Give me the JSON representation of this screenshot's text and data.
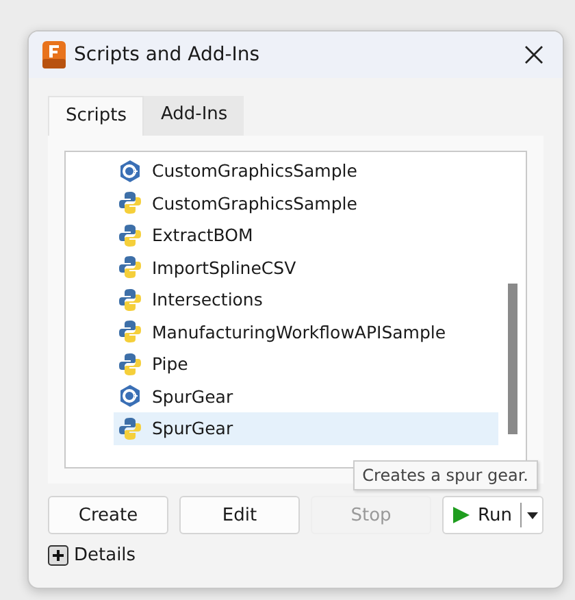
{
  "window": {
    "title": "Scripts and Add-Ins"
  },
  "tabs": [
    {
      "label": "Scripts",
      "selected": true
    },
    {
      "label": "Add-Ins",
      "selected": false
    }
  ],
  "scripts": [
    {
      "name": "CustomGraphicsSample",
      "kind": "cpp",
      "selected": false
    },
    {
      "name": "CustomGraphicsSample",
      "kind": "python",
      "selected": false
    },
    {
      "name": "ExtractBOM",
      "kind": "python",
      "selected": false
    },
    {
      "name": "ImportSplineCSV",
      "kind": "python",
      "selected": false
    },
    {
      "name": "Intersections",
      "kind": "python",
      "selected": false
    },
    {
      "name": "ManufacturingWorkflowAPISample",
      "kind": "python",
      "selected": false
    },
    {
      "name": "Pipe",
      "kind": "python",
      "selected": false
    },
    {
      "name": "SpurGear",
      "kind": "cpp",
      "selected": false
    },
    {
      "name": "SpurGear",
      "kind": "python",
      "selected": true
    }
  ],
  "tooltip": "Creates a spur gear.",
  "buttons": [
    {
      "label": "Create",
      "disabled": false
    },
    {
      "label": "Edit",
      "disabled": false
    },
    {
      "label": "Stop",
      "disabled": true
    }
  ],
  "run_button": {
    "label": "Run"
  },
  "details": {
    "label": "Details",
    "expanded": false
  }
}
